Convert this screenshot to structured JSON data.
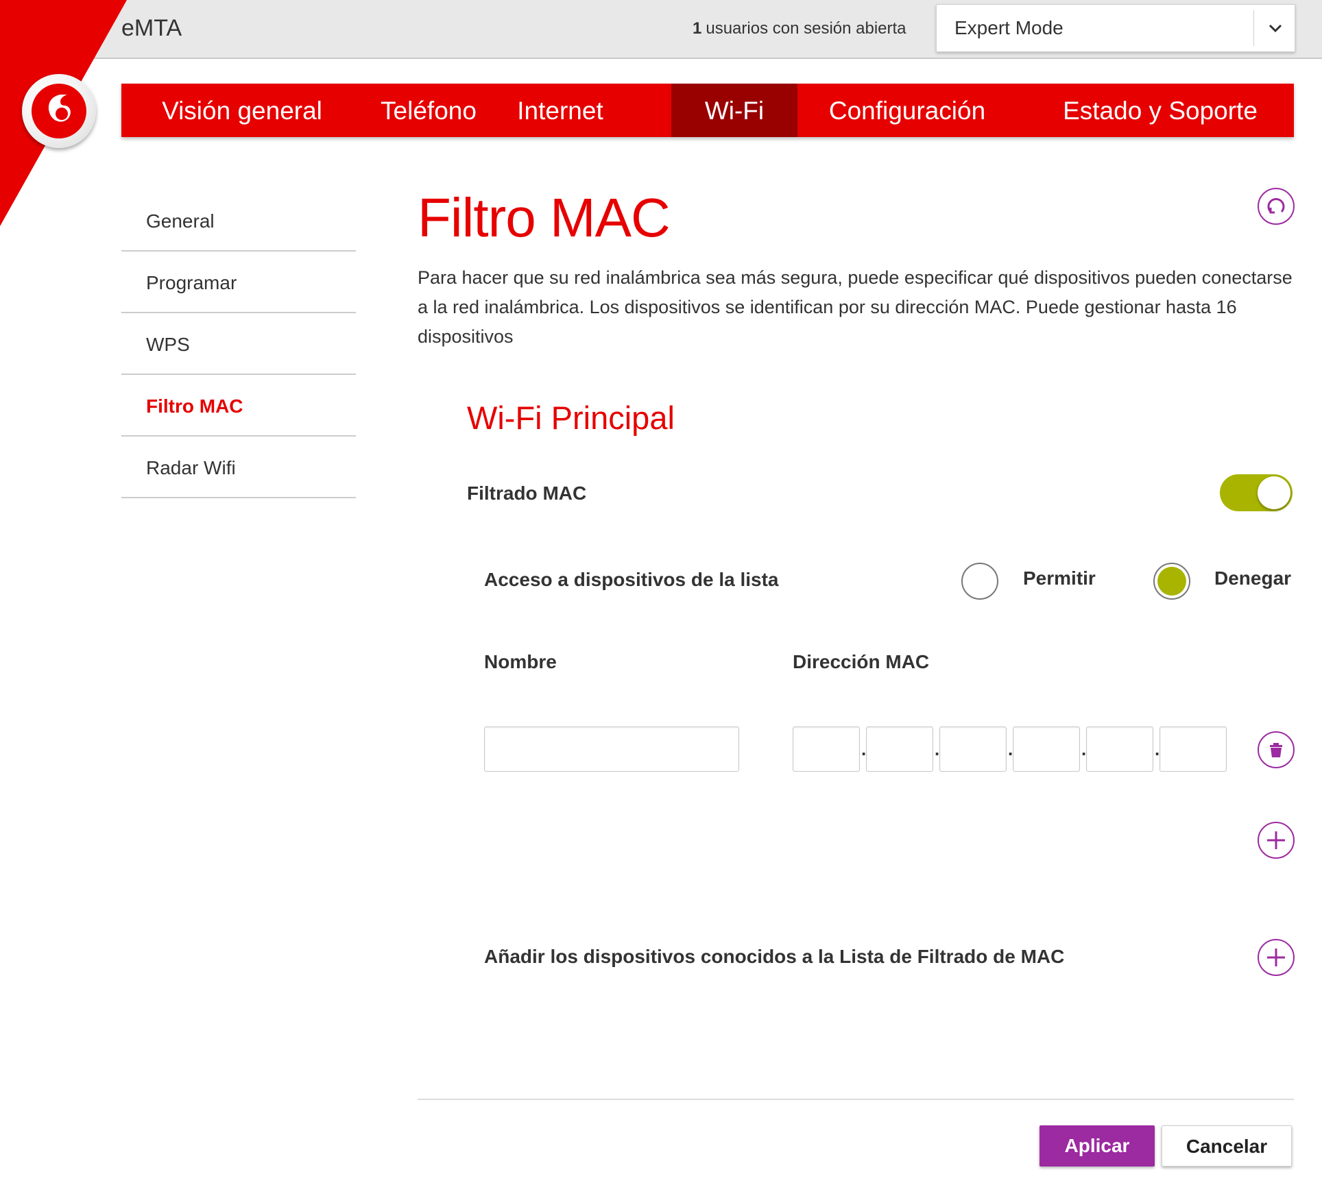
{
  "header": {
    "app_title": "eMTA",
    "sessions_count": "1",
    "sessions_text": "usuarios con sesión abierta",
    "mode_value": "Expert Mode"
  },
  "nav": {
    "tabs": [
      {
        "label": "Visión general"
      },
      {
        "label": "Teléfono"
      },
      {
        "label": "Internet"
      },
      {
        "label": "Wi-Fi",
        "active": true
      },
      {
        "label": "Configuración"
      },
      {
        "label": "Estado y Soporte"
      }
    ]
  },
  "sidebar": {
    "items": [
      {
        "label": "General"
      },
      {
        "label": "Programar"
      },
      {
        "label": "WPS"
      },
      {
        "label": "Filtro MAC",
        "active": true
      },
      {
        "label": "Radar Wifi"
      }
    ]
  },
  "main": {
    "title": "Filtro MAC",
    "description": "Para hacer que su red inalámbrica sea más segura, puede especificar qué dispositivos pueden conectarse a la red inalámbrica. Los dispositivos se identifican por su dirección MAC. Puede gestionar hasta 16 dispositivos",
    "section_title": "Wi-Fi Principal",
    "mac_filter_label": "Filtrado MAC",
    "mac_filter_enabled": true,
    "access_label": "Acceso a dispositivos de la lista",
    "access_options": [
      {
        "label": "Permitir",
        "selected": false
      },
      {
        "label": "Denegar",
        "selected": true
      }
    ],
    "col_name": "Nombre",
    "col_mac": "Dirección MAC",
    "mac_separator": ".",
    "known_devices_label": "Añadir los dispositivos conocidos a la Lista de Filtrado de MAC"
  },
  "actions": {
    "apply": "Aplicar",
    "cancel": "Cancelar"
  },
  "colors": {
    "brand_red": "#e60000",
    "active_tab": "#990000",
    "accent_purple": "#9c2aa0",
    "toggle_green": "#a8b400"
  },
  "icons": [
    "vodafone-logo",
    "chevron-down-icon",
    "refresh-icon",
    "trash-icon",
    "plus-icon"
  ]
}
